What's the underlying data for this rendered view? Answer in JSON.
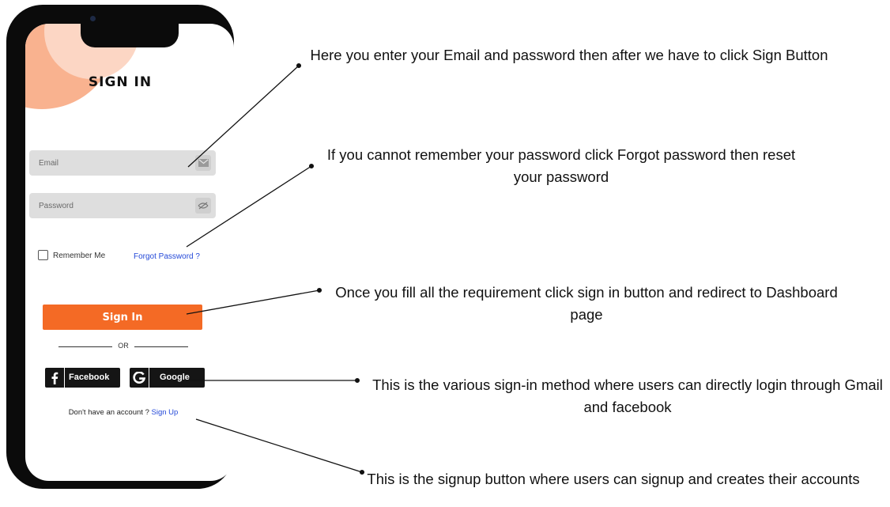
{
  "screen": {
    "title": "SIGN IN",
    "email": {
      "placeholder": "Email",
      "icon": "mail-icon"
    },
    "password": {
      "placeholder": "Password",
      "icon": "eye-off-icon"
    },
    "remember_me": "Remember Me",
    "forgot_password": "Forgot Password ?",
    "sign_in_button": "Sign In",
    "divider_text": "OR",
    "social": {
      "facebook": {
        "label": "Facebook",
        "icon": "facebook-icon"
      },
      "google": {
        "label": "Google",
        "icon": "google-icon"
      }
    },
    "signup_prompt": "Don't have an account ?",
    "signup_link": "Sign Up"
  },
  "colors": {
    "accent": "#f46a25",
    "decor_circle": "#f9b28f",
    "link": "#2449d8",
    "social_bg": "#151515",
    "field_bg": "#dedede"
  },
  "annotations": {
    "email_password": "Here  you enter your Email  and password   then after  we have to click Sign Button",
    "forgot_password": "If  you cannot remember your  password  click  Forgot password then  reset your  password",
    "sign_in": "Once  you fill all  the  requirement  click  sign in  button and redirect to Dashboard page",
    "social_methods": "This is the various sign-in method where users can directly login through Gmail and facebook",
    "signup": "This is the signup button where users can signup and creates their accounts"
  }
}
